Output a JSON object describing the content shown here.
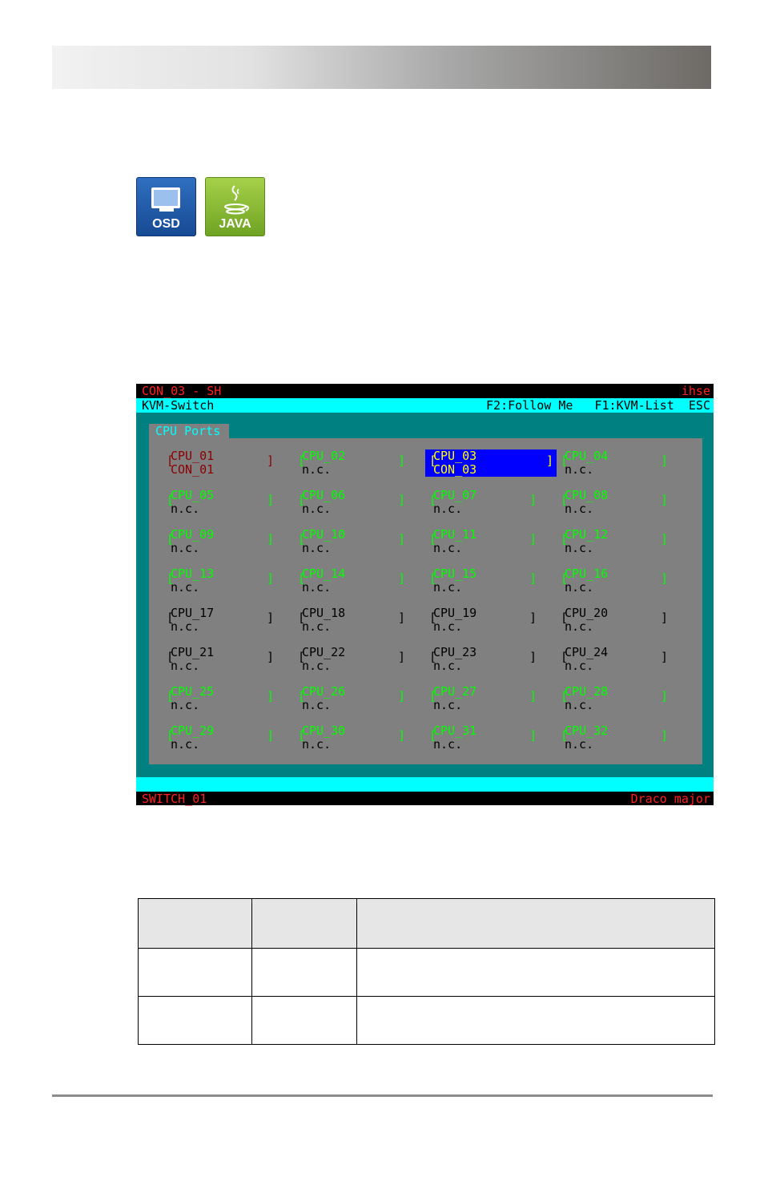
{
  "badges": {
    "osd": "OSD",
    "java": "JAVA"
  },
  "osd": {
    "top_left": "CON_03 - SH",
    "top_right": "ihse",
    "menu_title": "KVM-Switch",
    "hotkeys": "F2:Follow Me   F1:KVM-List  ESC",
    "panel_title": "CPU Ports",
    "status_left": "SWITCH_01",
    "status_right": "Draco major",
    "ports": [
      {
        "name": "CPU_01",
        "sub": "CON_01",
        "state": "connected"
      },
      {
        "name": "CPU_02",
        "sub": "n.c.",
        "state": "online"
      },
      {
        "name": "CPU_03",
        "sub": "CON_03",
        "state": "selected"
      },
      {
        "name": "CPU_04",
        "sub": "n.c.",
        "state": "online"
      },
      {
        "name": "CPU_05",
        "sub": "n.c.",
        "state": "online"
      },
      {
        "name": "CPU_06",
        "sub": "n.c.",
        "state": "online"
      },
      {
        "name": "CPU_07",
        "sub": "n.c.",
        "state": "online"
      },
      {
        "name": "CPU_08",
        "sub": "n.c.",
        "state": "online"
      },
      {
        "name": "CPU_09",
        "sub": "n.c.",
        "state": "online"
      },
      {
        "name": "CPU_10",
        "sub": "n.c.",
        "state": "online"
      },
      {
        "name": "CPU_11",
        "sub": "n.c.",
        "state": "online"
      },
      {
        "name": "CPU_12",
        "sub": "n.c.",
        "state": "online"
      },
      {
        "name": "CPU_13",
        "sub": "n.c.",
        "state": "online"
      },
      {
        "name": "CPU_14",
        "sub": "n.c.",
        "state": "online"
      },
      {
        "name": "CPU_15",
        "sub": "n.c.",
        "state": "online"
      },
      {
        "name": "CPU_16",
        "sub": "n.c.",
        "state": "online"
      },
      {
        "name": "CPU_17",
        "sub": "n.c.",
        "state": "offline"
      },
      {
        "name": "CPU_18",
        "sub": "n.c.",
        "state": "offline"
      },
      {
        "name": "CPU_19",
        "sub": "n.c.",
        "state": "offline"
      },
      {
        "name": "CPU_20",
        "sub": "n.c.",
        "state": "offline"
      },
      {
        "name": "CPU_21",
        "sub": "n.c.",
        "state": "offline"
      },
      {
        "name": "CPU_22",
        "sub": "n.c.",
        "state": "offline"
      },
      {
        "name": "CPU_23",
        "sub": "n.c.",
        "state": "offline"
      },
      {
        "name": "CPU_24",
        "sub": "n.c.",
        "state": "offline"
      },
      {
        "name": "CPU_25",
        "sub": "n.c.",
        "state": "online"
      },
      {
        "name": "CPU_26",
        "sub": "n.c.",
        "state": "online"
      },
      {
        "name": "CPU_27",
        "sub": "n.c.",
        "state": "online"
      },
      {
        "name": "CPU_28",
        "sub": "n.c.",
        "state": "online"
      },
      {
        "name": "CPU_29",
        "sub": "n.c.",
        "state": "online"
      },
      {
        "name": "CPU_30",
        "sub": "n.c.",
        "state": "online"
      },
      {
        "name": "CPU_31",
        "sub": "n.c.",
        "state": "online"
      },
      {
        "name": "CPU_32",
        "sub": "n.c.",
        "state": "online"
      }
    ]
  },
  "colors": {
    "osd_background": "#008080",
    "panel": "#808080",
    "bar_cyan": "#00ffff",
    "online": "#00ff00",
    "offline": "#000000",
    "connected": "#8b0000",
    "selected_bg": "#0000ff",
    "selected_fg": "#ffff00"
  }
}
